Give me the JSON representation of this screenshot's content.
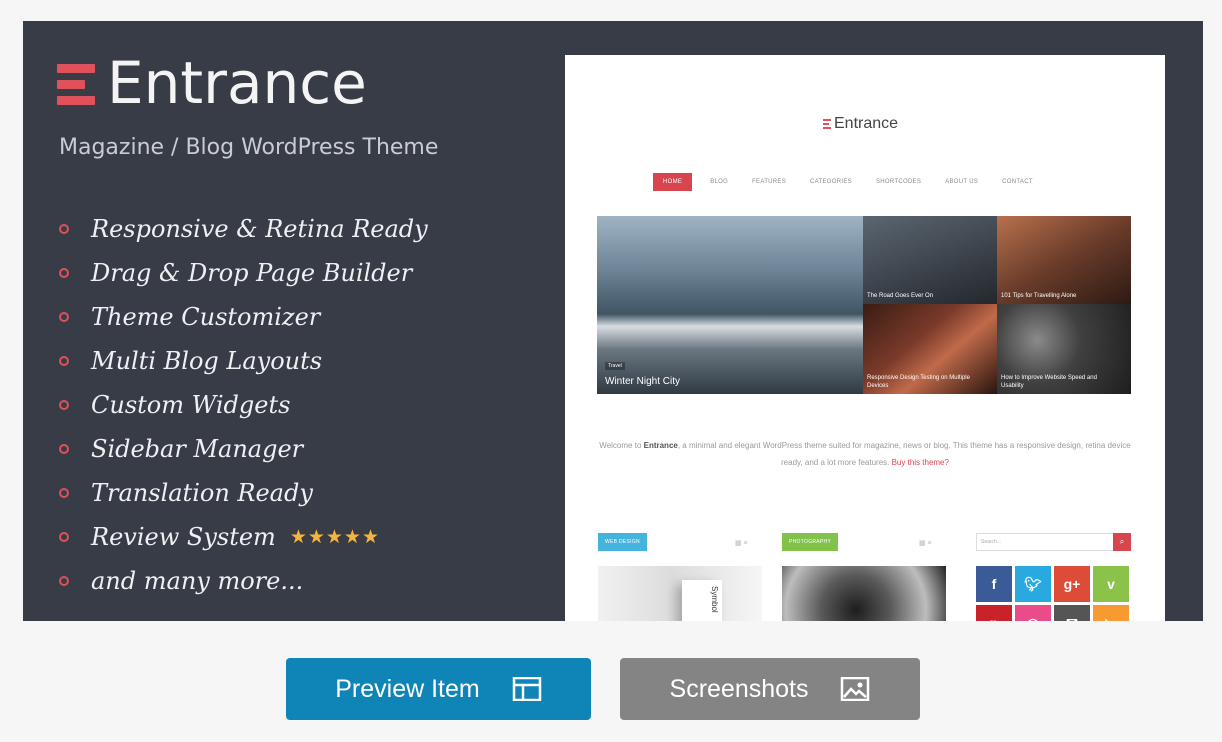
{
  "banner": {
    "logo_text": "Entrance",
    "tagline": "Magazine / Blog WordPress Theme",
    "features": [
      "Responsive & Retina Ready",
      "Drag & Drop Page Builder",
      "Theme Customizer",
      "Multi Blog Layouts",
      "Custom Widgets",
      "Sidebar Manager",
      "Translation Ready",
      "Review System",
      "and many more..."
    ],
    "stars": "★★★★★",
    "accent_color": "#e0515b",
    "background_color": "#383c47"
  },
  "preview": {
    "logo_text": "Entrance",
    "nav": [
      "HOME",
      "BLOG",
      "FEATURES",
      "CATEGORIES",
      "SHORTCODES",
      "ABOUT US",
      "CONTACT"
    ],
    "tiles": {
      "big_tag": "Travel",
      "big_caption": "Winter Night City",
      "t1": "The Road Goes Ever On",
      "t2": "101 Tips for Travelling Alone",
      "t3": "Responsive Design Testing on Multiple Devices",
      "t4": "How to Improve Website Speed and Usability"
    },
    "welcome": {
      "prefix": "Welcome to ",
      "brand": "Entrance",
      "text": ", a minimal and elegant WordPress theme suited for magazine, news or blog. This theme has a responsive design, retina device ready, and a lot more features. ",
      "link": "Buy this theme?"
    },
    "cat_1": "WEB DESIGN",
    "cat_2": "PHOTOGRAPHY",
    "search_placeholder": "Search...",
    "thumb_text": "Symbol",
    "social": [
      {
        "icon": "f",
        "color": "#3b5b98"
      },
      {
        "icon": "t",
        "color": "#2aa9e0"
      },
      {
        "icon": "g+",
        "color": "#dd4b39"
      },
      {
        "icon": "v",
        "color": "#8bc34a"
      },
      {
        "icon": "p",
        "color": "#c92228"
      },
      {
        "icon": "d",
        "color": "#ea4c89"
      },
      {
        "icon": "m",
        "color": "#555555"
      },
      {
        "icon": "r",
        "color": "#f79a32"
      }
    ]
  },
  "buttons": {
    "preview_label": "Preview Item",
    "screenshots_label": "Screenshots",
    "preview_color": "#0f84b6",
    "screenshots_color": "#848484"
  }
}
